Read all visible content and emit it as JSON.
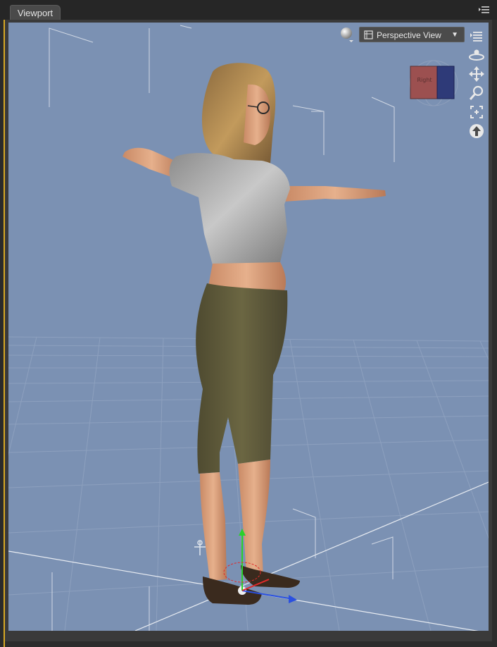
{
  "tab": {
    "label": "Viewport"
  },
  "viewport": {
    "view_mode": "Perspective View",
    "cube_face_label": "Right"
  },
  "icons": {
    "panel_menu": "panel-menu-icon",
    "draw_style": "draw-style-sphere-icon",
    "view_options": "view-options-icon",
    "orbit": "orbit-icon",
    "pan": "pan-icon",
    "zoom": "zoom-icon",
    "frame": "frame-icon",
    "reset": "reset-view-icon"
  },
  "colors": {
    "viewport_bg": "#7b91b3",
    "accent_strip": "#d7a824",
    "panel_bg": "#3a3a3a"
  }
}
